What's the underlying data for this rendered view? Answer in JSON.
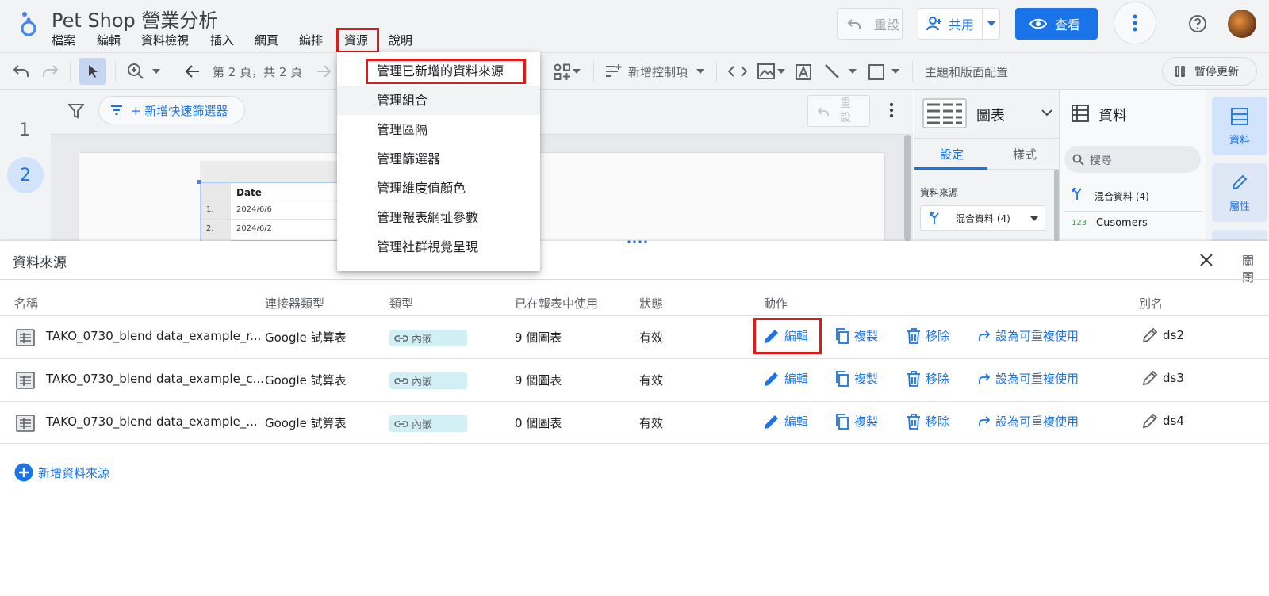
{
  "header": {
    "app_title": "Pet Shop 營業分析",
    "menu": [
      "檔案",
      "編輯",
      "資料檢視",
      "插入",
      "網頁",
      "編排",
      "資源",
      "說明"
    ],
    "reset_label": "重設",
    "share_label": "共用",
    "view_label": "查看"
  },
  "toolbar": {
    "page_info": "第 2 頁，共 2 頁",
    "add_control": "新增控制項",
    "theme_layout": "主題和版面配置",
    "pause_update": "暫停更新"
  },
  "left_rail": {
    "pages": [
      "1",
      "2"
    ]
  },
  "filter_bar": {
    "add_quick_filter": "+ 新增快速篩選器",
    "reset_label": "重設"
  },
  "canvas_table": {
    "header": "Date",
    "rows": [
      {
        "idx": "1.",
        "date": "2024/6/6"
      },
      {
        "idx": "2.",
        "date": "2024/6/2"
      }
    ]
  },
  "prop_panel": {
    "chart_label": "圖表",
    "tab_setup": "設定",
    "tab_style": "樣式",
    "data_source_heading": "資料來源",
    "data_source_value": "混合資料 (4)"
  },
  "data_panel": {
    "title": "資料",
    "search_placeholder": "搜尋",
    "items": [
      "混合資料 (4)",
      "Cusomers"
    ],
    "type_badge": "123"
  },
  "side_tabs": {
    "data": "資料",
    "properties": "屬性"
  },
  "resource_menu": {
    "items": [
      "管理已新增的資料來源",
      "管理組合",
      "管理區隔",
      "管理篩選器",
      "管理維度值顏色",
      "管理報表網址參數",
      "管理社群視覺呈現"
    ]
  },
  "ds_panel": {
    "title": "資料來源",
    "close_label": "關閉",
    "columns": [
      "名稱",
      "連接器類型",
      "類型",
      "已在報表中使用",
      "狀態",
      "動作",
      "別名"
    ],
    "rows": [
      {
        "name": "TAKO_0730_blend data_example_r...",
        "connector": "Google 試算表",
        "type": "內嵌",
        "used": "9 個圖表",
        "status": "有效",
        "alias": "ds2"
      },
      {
        "name": "TAKO_0730_blend data_example_c...",
        "connector": "Google 試算表",
        "type": "內嵌",
        "used": "9 個圖表",
        "status": "有效",
        "alias": "ds3"
      },
      {
        "name": "TAKO_0730_blend data_example_...",
        "connector": "Google 試算表",
        "type": "內嵌",
        "used": "0 個圖表",
        "status": "有效",
        "alias": "ds4"
      }
    ],
    "actions": {
      "edit": "編輯",
      "copy": "複製",
      "remove": "移除",
      "reusable": "設為可重複使用"
    },
    "add_source": "新增資料來源"
  },
  "colors": {
    "accent": "#1a73e8",
    "highlight": "#e01919",
    "chip_bg": "#d2eff6"
  }
}
